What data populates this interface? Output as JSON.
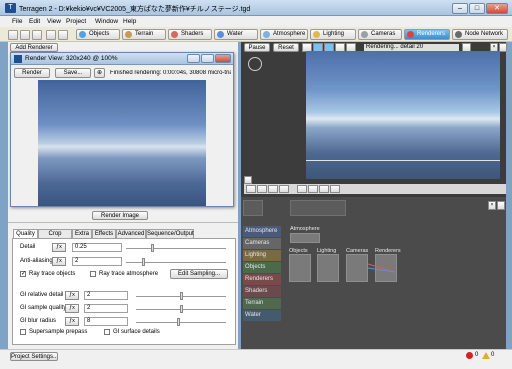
{
  "window": {
    "title": "Terragen 2 - D:¥kekio¥vc¥VC2005_東方ぱなた夢新作¥チルノステージ.tgd"
  },
  "menu": [
    "File",
    "Edit",
    "View",
    "Project",
    "Window",
    "Help"
  ],
  "toolbar_tabs": [
    {
      "label": "Objects",
      "color": "#5aa0d8"
    },
    {
      "label": "Terrain",
      "color": "#c89a55"
    },
    {
      "label": "Shaders",
      "color": "#d66a5f"
    },
    {
      "label": "Water",
      "color": "#5c8fd6"
    },
    {
      "label": "Atmosphere",
      "color": "#7fb0e0"
    },
    {
      "label": "Lighting",
      "color": "#e0b94a"
    },
    {
      "label": "Cameras",
      "color": "#9aa0a8"
    },
    {
      "label": "Renderers",
      "color": "#e04040"
    },
    {
      "label": "Node Network",
      "color": "#6a6a6a"
    }
  ],
  "left_panel": {
    "add_button": "Add Renderer",
    "render_image_button": "Render Image"
  },
  "render_view": {
    "title": "Render View: 320x240 @ 100%",
    "render_button": "Render",
    "save_button": "Save...",
    "status": "Finished rendering: 0:00:04s, 30808 micro-triangle"
  },
  "viewport_toolbar": {
    "pause": "Pause",
    "reset": "Reset",
    "status": "Rendering... detail 20"
  },
  "tabs": [
    "Quality",
    "Crop Region",
    "Extra",
    "Effects",
    "Advanced",
    "Sequence/Output"
  ],
  "quality": {
    "detail_label": "Detail",
    "detail_value": "0.25",
    "detail_level": 0.25,
    "aa_label": "Anti-aliasing",
    "aa_value": "2",
    "ray_objects": "Ray trace objects",
    "ray_atmo": "Ray trace atmosphere",
    "edit_sampling": "Edit Sampling...",
    "gi_rel_label": "GI relative detail",
    "gi_rel_value": "2",
    "gi_sample_label": "GI sample quality",
    "gi_sample_value": "2",
    "gi_blur_label": "GI blur radius",
    "gi_blur_value": "8",
    "supersample": "Supersample prepass",
    "gi_surface": "GI surface details"
  },
  "node_list": [
    "Atmosphere",
    "Cameras",
    "Lighting",
    "Objects",
    "Renderers",
    "Shaders",
    "Terrain",
    "Water"
  ],
  "node_list_colors": [
    "#4a5a7a",
    "#666666",
    "#7a6a44",
    "#4a6a4a",
    "#7a4a4a",
    "#6a4a4a",
    "#4e6a4e",
    "#445a6e"
  ],
  "network_nodes": [
    "Atmosphere",
    "Objects",
    "Lighting",
    "Cameras",
    "Renderers"
  ],
  "status_bar": {
    "project_settings": "Project Settings...",
    "errors": "0",
    "warnings": "0"
  }
}
